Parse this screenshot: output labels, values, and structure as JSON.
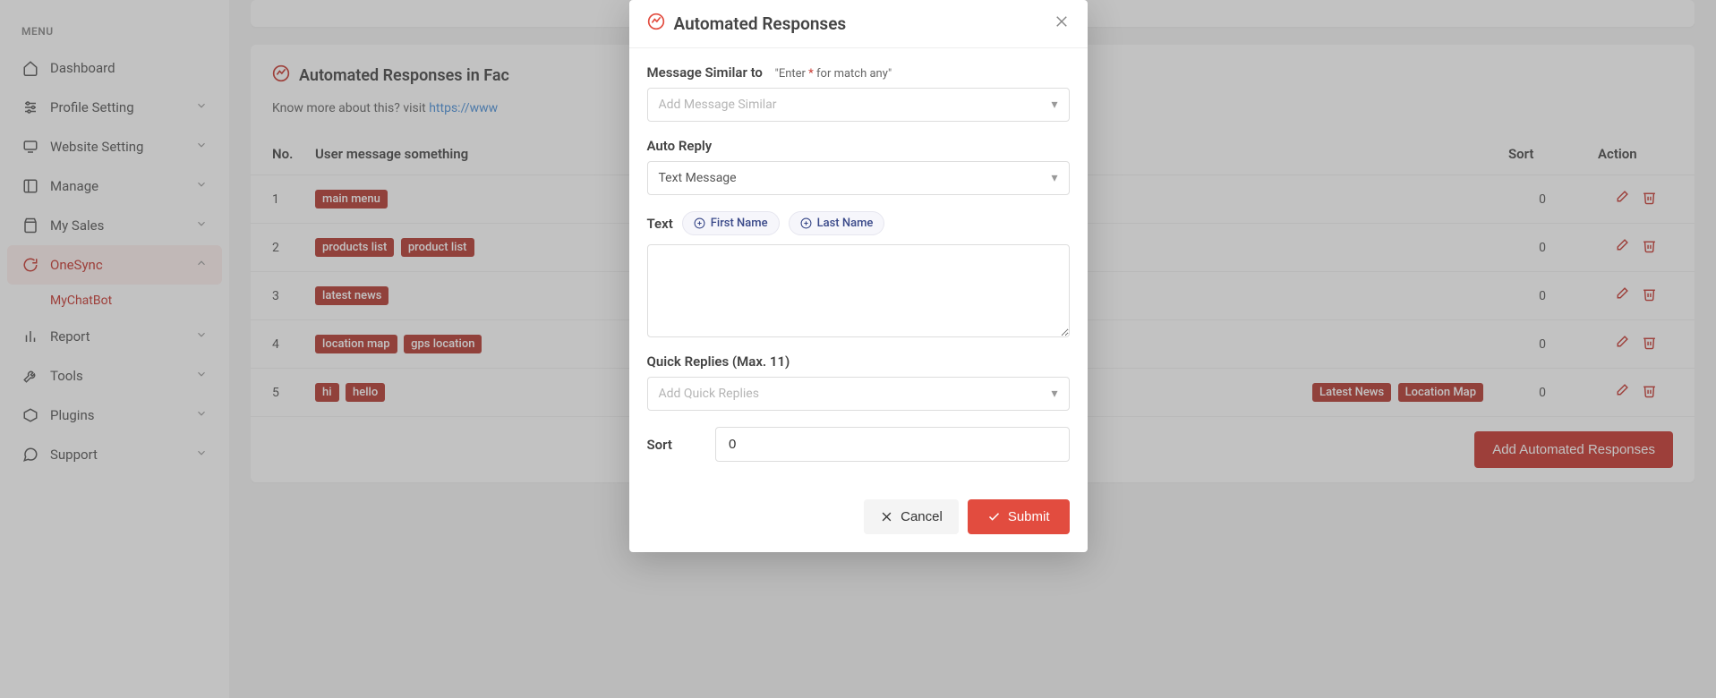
{
  "sidebar": {
    "menu_label": "MENU",
    "items": [
      {
        "label": "Dashboard",
        "icon": "home",
        "expandable": false
      },
      {
        "label": "Profile Setting",
        "icon": "sliders",
        "expandable": true
      },
      {
        "label": "Website Setting",
        "icon": "monitor",
        "expandable": true
      },
      {
        "label": "Manage",
        "icon": "layout",
        "expandable": true
      },
      {
        "label": "My Sales",
        "icon": "bag",
        "expandable": true
      },
      {
        "label": "OneSync",
        "icon": "refresh",
        "expandable": true,
        "active": true
      },
      {
        "label": "Report",
        "icon": "bar-chart",
        "expandable": true
      },
      {
        "label": "Tools",
        "icon": "wrench",
        "expandable": true
      },
      {
        "label": "Plugins",
        "icon": "box",
        "expandable": true
      },
      {
        "label": "Support",
        "icon": "chat",
        "expandable": true
      }
    ],
    "onesync_sub": "MyChatBot"
  },
  "page": {
    "header_title": "Automated Responses in Fac",
    "hint_prefix": "Know more about this? visit ",
    "hint_link": "https://www",
    "add_button": "Add Automated Responses",
    "columns": {
      "no": "No.",
      "user_msg": "User message something",
      "sort": "Sort",
      "action": "Action"
    },
    "rows": [
      {
        "no": "1",
        "tags": [
          "main menu"
        ],
        "sort": "0"
      },
      {
        "no": "2",
        "tags": [
          "products list",
          "product list"
        ],
        "sort": "0"
      },
      {
        "no": "3",
        "tags": [
          "latest news"
        ],
        "sort": "0"
      },
      {
        "no": "4",
        "tags": [
          "location map",
          "gps location"
        ],
        "sort": "0"
      },
      {
        "no": "5",
        "tags": [
          "hi",
          "hello"
        ],
        "extra_tags": [
          "Latest News",
          "Location Map"
        ],
        "sort": "0"
      }
    ]
  },
  "modal": {
    "title": "Automated Responses",
    "msg_similar_label": "Message Similar to",
    "msg_similar_hint_prefix": "\"Enter ",
    "msg_similar_hint_star": "*",
    "msg_similar_hint_suffix": " for match any\"",
    "msg_similar_placeholder": "Add Message Similar",
    "auto_reply_label": "Auto Reply",
    "auto_reply_value": "Text Message",
    "text_label": "Text",
    "chip_first_name": "First Name",
    "chip_last_name": "Last Name",
    "quick_replies_label": "Quick Replies (Max. 11)",
    "quick_replies_placeholder": "Add Quick Replies",
    "sort_label": "Sort",
    "sort_value": "0",
    "cancel": "Cancel",
    "submit": "Submit"
  }
}
